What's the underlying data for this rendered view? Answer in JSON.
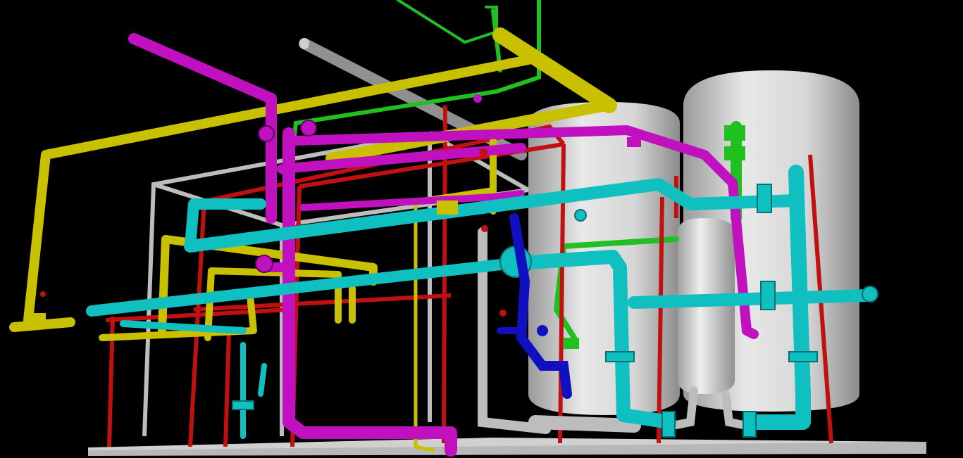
{
  "scene": {
    "background": "#000000",
    "pipe_colors": {
      "yellow": "#c8c000",
      "magenta": "#c010c0",
      "cyan": "#10c0c0",
      "green": "#20c020",
      "red_structure": "#c01010",
      "gray_pipe": "#909090",
      "blue": "#1010c0",
      "tank": "#d8d8d8",
      "frame": "#bdbdbd",
      "floor": "#c8c8c8"
    }
  }
}
